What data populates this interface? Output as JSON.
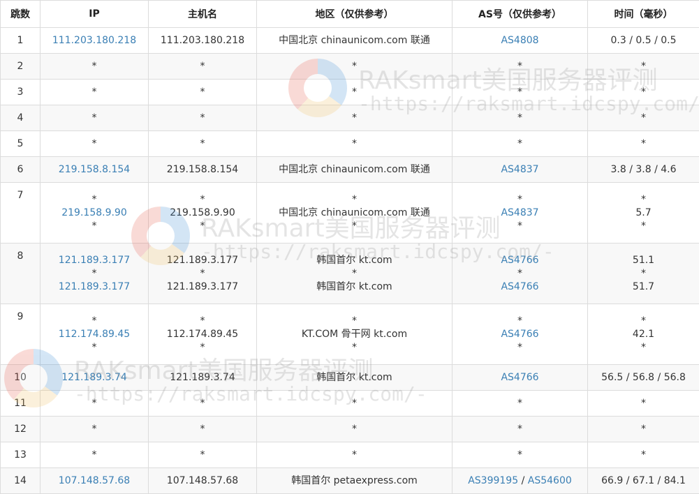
{
  "headers": [
    "跳数",
    "IP",
    "主机名",
    "地区（仅供参考）",
    "AS号（仅供参考）",
    "时间（毫秒）"
  ],
  "rows": [
    {
      "hop": "1",
      "ip": [
        "111.203.180.218"
      ],
      "host": [
        "111.203.180.218"
      ],
      "region": [
        "中国北京 chinaunicom.com 联通"
      ],
      "as": [
        "AS4808"
      ],
      "time": [
        "0.3 / 0.5 / 0.5"
      ]
    },
    {
      "hop": "2",
      "ip": [
        "*"
      ],
      "host": [
        "*"
      ],
      "region": [
        "*"
      ],
      "as": [
        "*"
      ],
      "time": [
        "*"
      ]
    },
    {
      "hop": "3",
      "ip": [
        "*"
      ],
      "host": [
        "*"
      ],
      "region": [
        "*"
      ],
      "as": [
        "*"
      ],
      "time": [
        "*"
      ]
    },
    {
      "hop": "4",
      "ip": [
        "*"
      ],
      "host": [
        "*"
      ],
      "region": [
        "*"
      ],
      "as": [
        "*"
      ],
      "time": [
        "*"
      ]
    },
    {
      "hop": "5",
      "ip": [
        "*"
      ],
      "host": [
        "*"
      ],
      "region": [
        "*"
      ],
      "as": [
        "*"
      ],
      "time": [
        "*"
      ]
    },
    {
      "hop": "6",
      "ip": [
        "219.158.8.154"
      ],
      "host": [
        "219.158.8.154"
      ],
      "region": [
        "中国北京 chinaunicom.com 联通"
      ],
      "as": [
        "AS4837"
      ],
      "time": [
        "3.8 / 3.8 / 4.6"
      ]
    },
    {
      "hop": "7",
      "ip": [
        "*",
        "219.158.9.90",
        "*"
      ],
      "host": [
        "*",
        "219.158.9.90",
        "*"
      ],
      "region": [
        "*",
        "中国北京 chinaunicom.com 联通",
        "*"
      ],
      "as": [
        "*",
        "AS4837",
        "*"
      ],
      "time": [
        "*",
        "5.7",
        "*"
      ]
    },
    {
      "hop": "8",
      "ip": [
        "121.189.3.177",
        "*",
        "121.189.3.177"
      ],
      "host": [
        "121.189.3.177",
        "*",
        "121.189.3.177"
      ],
      "region": [
        "韩国首尔 kt.com",
        "*",
        "韩国首尔 kt.com"
      ],
      "as": [
        "AS4766",
        "*",
        "AS4766"
      ],
      "time": [
        "51.1",
        "*",
        "51.7"
      ]
    },
    {
      "hop": "9",
      "ip": [
        "*",
        "112.174.89.45",
        "*"
      ],
      "host": [
        "*",
        "112.174.89.45",
        "*"
      ],
      "region": [
        "*",
        "KT.COM 骨干网 kt.com",
        "*"
      ],
      "as": [
        "*",
        "AS4766",
        "*"
      ],
      "time": [
        "*",
        "42.1",
        "*"
      ]
    },
    {
      "hop": "10",
      "ip": [
        "121.189.3.74"
      ],
      "host": [
        "121.189.3.74"
      ],
      "region": [
        "韩国首尔 kt.com"
      ],
      "as": [
        "AS4766"
      ],
      "time": [
        "56.5 / 56.8 / 56.8"
      ]
    },
    {
      "hop": "11",
      "ip": [
        "*"
      ],
      "host": [
        "*"
      ],
      "region": [
        "*"
      ],
      "as": [
        "*"
      ],
      "time": [
        "*"
      ]
    },
    {
      "hop": "12",
      "ip": [
        "*"
      ],
      "host": [
        "*"
      ],
      "region": [
        "*"
      ],
      "as": [
        "*"
      ],
      "time": [
        "*"
      ]
    },
    {
      "hop": "13",
      "ip": [
        "*"
      ],
      "host": [
        "*"
      ],
      "region": [
        "*"
      ],
      "as": [
        "*"
      ],
      "time": [
        "*"
      ]
    },
    {
      "hop": "14",
      "ip": [
        "107.148.57.68"
      ],
      "host": [
        "107.148.57.68"
      ],
      "region": [
        "韩国首尔 petaexpress.com"
      ],
      "as": [
        "AS399195",
        "AS54600"
      ],
      "time": [
        "66.9 / 67.1 / 84.1"
      ]
    }
  ],
  "watermark": {
    "title": "RAKsmart美国服务器评测",
    "url": "-https://raksmart.idcspy.com/-"
  },
  "colors": {
    "link": "#3a7fb4",
    "border": "#dcdcdc",
    "row_alt": "#f8f8f8"
  }
}
